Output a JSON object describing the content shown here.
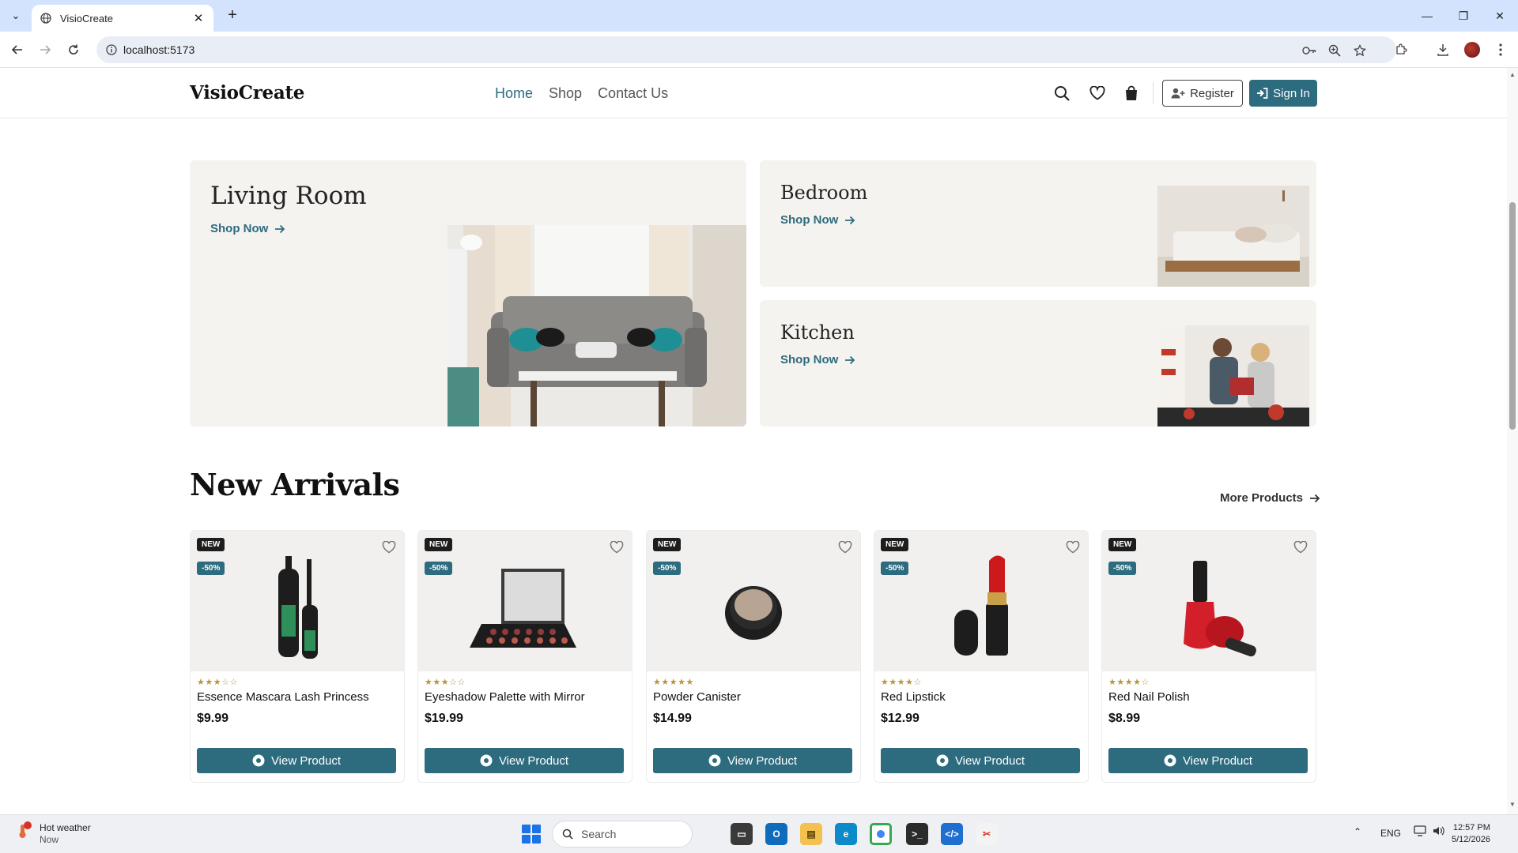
{
  "browser": {
    "tab_title": "VisioCreate",
    "url": "localhost:5173"
  },
  "site": {
    "logo": "VisioCreate",
    "nav": [
      "Home",
      "Shop",
      "Contact Us"
    ],
    "register_label": "Register",
    "signin_label": "Sign In",
    "accent_color": "#2d6b7e"
  },
  "categories": {
    "living": {
      "title": "Living Room",
      "cta": "Shop Now"
    },
    "bedroom": {
      "title": "Bedroom",
      "cta": "Shop Now"
    },
    "kitchen": {
      "title": "Kitchen",
      "cta": "Shop Now"
    }
  },
  "new_arrivals": {
    "title": "New Arrivals",
    "more_label": "More Products",
    "products": [
      {
        "badge": "NEW",
        "discount": "-50%",
        "rating": "★★★☆☆",
        "name": "Essence Mascara Lash Princess",
        "price": "$9.99",
        "button": "View Product",
        "icon": "mascara"
      },
      {
        "badge": "NEW",
        "discount": "-50%",
        "rating": "★★★☆☆",
        "name": "Eyeshadow Palette with Mirror",
        "price": "$19.99",
        "button": "View Product",
        "icon": "palette"
      },
      {
        "badge": "NEW",
        "discount": "-50%",
        "rating": "★★★★★",
        "name": "Powder Canister",
        "price": "$14.99",
        "button": "View Product",
        "icon": "powder"
      },
      {
        "badge": "NEW",
        "discount": "-50%",
        "rating": "★★★★☆",
        "name": "Red Lipstick",
        "price": "$12.99",
        "button": "View Product",
        "icon": "lipstick"
      },
      {
        "badge": "NEW",
        "discount": "-50%",
        "rating": "★★★★☆",
        "name": "Red Nail Polish",
        "price": "$8.99",
        "button": "View Product",
        "icon": "nail-polish"
      }
    ]
  },
  "taskbar": {
    "weather_title": "Hot weather",
    "weather_sub": "Now",
    "search_placeholder": "Search",
    "lang": "ENG",
    "time": "12:57 PM",
    "date": "5/12/2026"
  }
}
